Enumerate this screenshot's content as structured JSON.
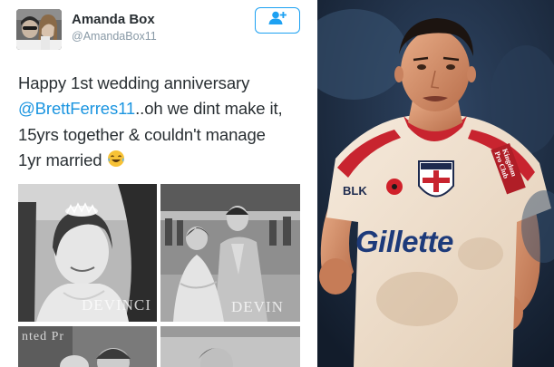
{
  "tweet": {
    "display_name": "Amanda Box",
    "handle": "@AmandaBox11",
    "text_line1": "Happy 1st wedding anniversary",
    "mention": "@BrettFerres11",
    "text_line2_rest": "..oh we dint make it,",
    "text_line3": "15yrs together & couldn't manage",
    "text_line4": "1yr married",
    "emoji": "face-with-tears-of-joy-icon",
    "follow_icon": "add-user-icon",
    "accent_color": "#1da1f2"
  },
  "photos": {
    "watermark_1": "DEVINCI",
    "watermark_2": "DEVIN",
    "watermark_3": "nted Pr"
  },
  "player": {
    "kit_brand": "BLK",
    "sponsor": "Gillette",
    "sleeve_sponsor": "Kingdom Pro Club",
    "poppy_icon": "poppy-icon",
    "badge_icon": "england-crest-icon"
  }
}
